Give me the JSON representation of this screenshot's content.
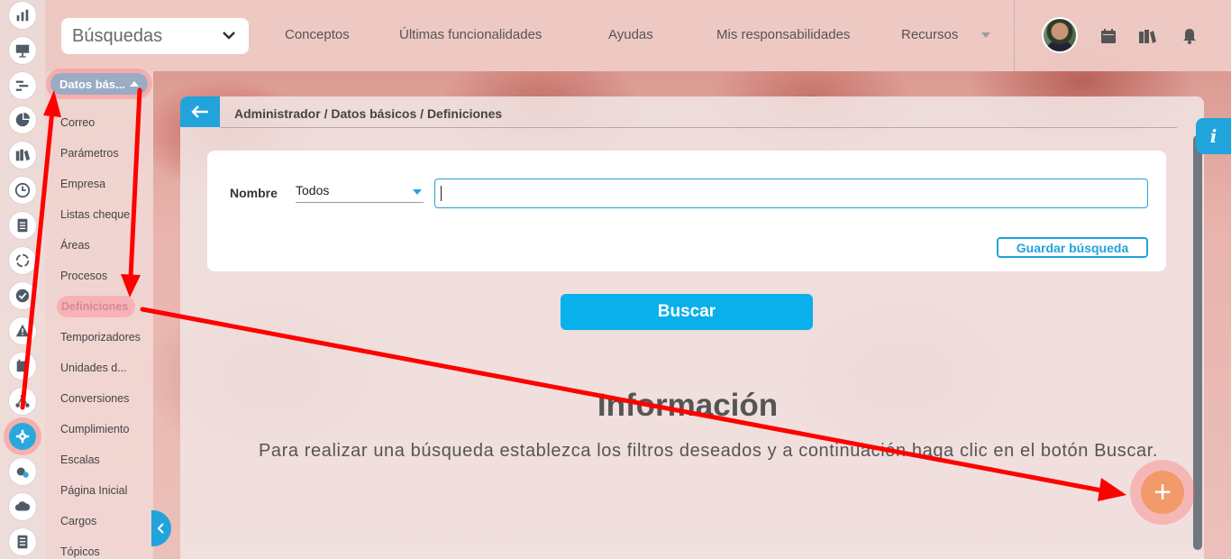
{
  "topbar": {
    "search_select_value": "Búsquedas",
    "nav": [
      "Conceptos",
      "Últimas funcionalidades",
      "Ayudas",
      "Mis responsabilidades",
      "Recursos"
    ]
  },
  "rail": {
    "icons": [
      "chart-icon",
      "presentation-icon",
      "gantt-icon",
      "pie-icon",
      "books-icon",
      "clock-icon",
      "document-icon",
      "cycle-icon",
      "check-icon",
      "alert-icon",
      "calendar-icon",
      "network-icon",
      "gear-icon",
      "cloud-gear-icon",
      "cloud-icon",
      "list-icon"
    ],
    "active": "gear-icon"
  },
  "submenu": {
    "header": "Datos bás...",
    "items": [
      "Correo",
      "Parámetros",
      "Empresa",
      "Listas cheque",
      "Áreas",
      "Procesos",
      "Definiciones",
      "Temporizadores",
      "Unidades d...",
      "Conversiones",
      "Cumplimiento",
      "Escalas",
      "Página Inicial",
      "Cargos",
      "Tópicos"
    ],
    "active_item": "Definiciones"
  },
  "main": {
    "breadcrumb": "Administrador / Datos básicos / Definiciones",
    "filter_label": "Nombre",
    "filter_select": "Todos",
    "filter_value": "",
    "save_search_label": "Guardar búsqueda",
    "search_button": "Buscar",
    "info_title": "Información",
    "info_text": "Para realizar una búsqueda establezca los filtros deseados y a continuación haga clic en el botón Buscar.",
    "info_tab": "i",
    "fab_label": "+"
  },
  "colors": {
    "accent": "#21a3dc",
    "fab": "#f29a6a",
    "annotation": "#ff0000"
  }
}
